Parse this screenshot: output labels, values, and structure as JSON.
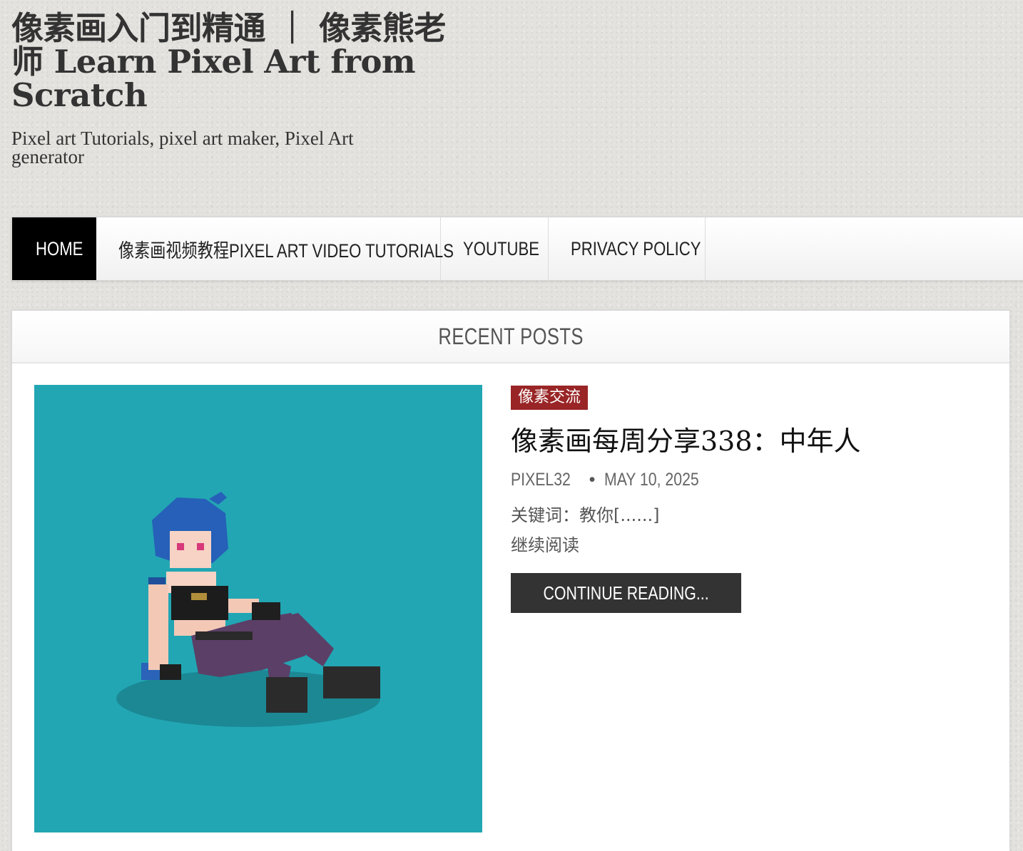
{
  "site": {
    "title": "像素画入门到精通 ｜ 像素熊老师 Learn Pixel Art from Scratch",
    "tagline": "Pixel art Tutorials, pixel art maker, Pixel Art generator"
  },
  "nav": {
    "items": [
      {
        "label": "HOME",
        "active": true
      },
      {
        "label": "像素画视频教程PIXEL ART VIDEO TUTORIALS",
        "active": false
      },
      {
        "label": "YOUTUBE",
        "active": false
      },
      {
        "label": "PRIVACY POLICY",
        "active": false
      }
    ]
  },
  "recent": {
    "heading": "RECENT POSTS",
    "post": {
      "category": "像素交流",
      "title": "像素画每周分享338：中年人",
      "author": "PIXEL32",
      "date": "MAY 10, 2025",
      "excerpt": "关键词：教你[......]",
      "read_more_link": "继续阅读",
      "continue_button": "CONTINUE READING..."
    }
  },
  "colors": {
    "accent_category": "#992526",
    "thumbnail_bg": "#22a6b3",
    "nav_active_bg": "#000000",
    "button_bg": "#333333"
  }
}
